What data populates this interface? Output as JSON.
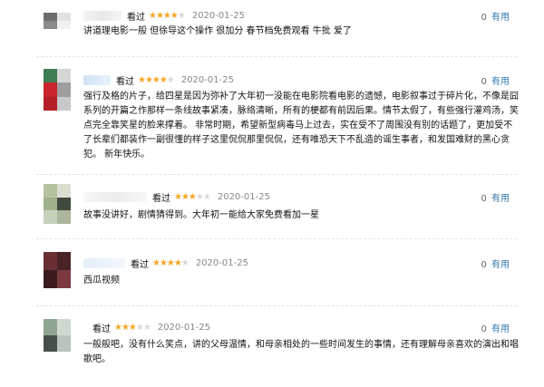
{
  "reviews": [
    {
      "seen": "看过",
      "stars_on": "★★★★",
      "stars_off": "★",
      "date": "2020-01-25",
      "useful_count": "0",
      "useful_label": "有用",
      "text": "讲道理电影一般 但徐导这个操作 很加分 春节档免费观看 牛批 爱了"
    },
    {
      "seen": "看过",
      "stars_on": "★★★★",
      "stars_off": "★",
      "date": "2020-01-25",
      "useful_count": "0",
      "useful_label": "有用",
      "text": "强行及格的片子，给四星是因为弥补了大年初一没能在电影院看电影的遗憾，电影叙事过于碎片化，不像是囧系列的开篇之作那样一条线故事紧凑，脉络清晰，所有的梗都有前因后果。情节太假了，有些强行灌鸡汤，笑点完全靠笑星的脸来撑着。 非常时期，希望新型病毒马上过去，实在受不了周围没有别的话题了，更加受不了长辈们都装作一副很懂的样子这里侃侃那里侃侃，还有唯恐天下不乱造的谣生事者，和发国难财的黑心贪犯。 新年快乐。"
    },
    {
      "seen": "看过",
      "stars_on": "★★★",
      "stars_off": "★★",
      "date": "2020-01-25",
      "useful_count": "0",
      "useful_label": "有用",
      "text": "故事没讲好，剧情猜得到。大年初一能给大家免费看加一星"
    },
    {
      "seen": "看过",
      "stars_on": "★★★★",
      "stars_off": "★",
      "date": "2020-01-25",
      "useful_count": "0",
      "useful_label": "有用",
      "text": "西瓜视频"
    },
    {
      "seen": "看过",
      "stars_on": "★★★",
      "stars_off": "★★",
      "date": "2020-01-25",
      "useful_count": "0",
      "useful_label": "有用",
      "text": "一般般吧，没有什么笑点，讲的父母温情，和母亲相处的一些时间发生的事情，还有理解母亲喜欢的演出和唱歌吧。"
    }
  ],
  "colors": {
    "star": "#f5a623",
    "link": "#3377aa"
  }
}
